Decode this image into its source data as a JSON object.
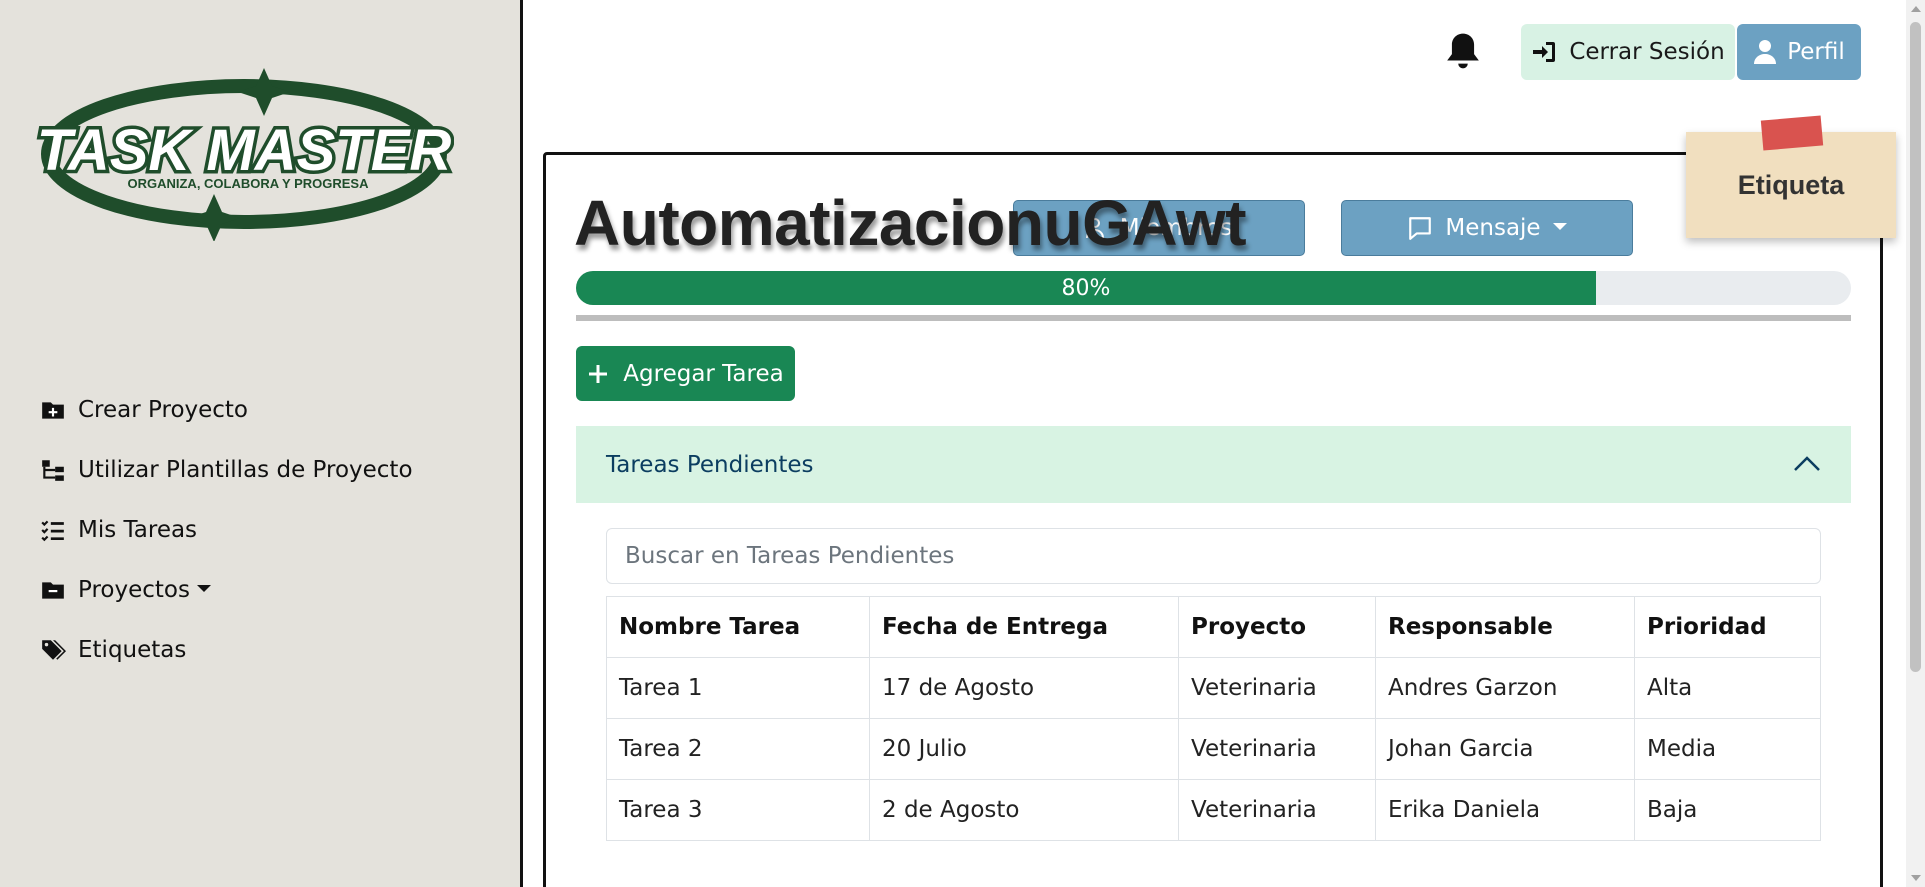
{
  "sidebar": {
    "logo": {
      "title": "TASK MASTER",
      "tagline": "ORGANIZA, COLABORA Y PROGRESA",
      "color": "#1f4d2b"
    },
    "items": [
      {
        "label": "Crear Proyecto",
        "icon": "folder-plus-icon"
      },
      {
        "label": "Utilizar Plantillas de Proyecto",
        "icon": "diagram-icon"
      },
      {
        "label": "Mis Tareas",
        "icon": "list-check-icon"
      },
      {
        "label": "Proyectos",
        "icon": "folder-minus-icon"
      },
      {
        "label": "Etiquetas",
        "icon": "tags-icon"
      }
    ]
  },
  "header": {
    "notifications_icon": "bell-icon",
    "logout_label": "Cerrar Sesión",
    "profile_label": "Perfil"
  },
  "note": {
    "label": "Etiqueta"
  },
  "project": {
    "title": "AutomatizacionuGAwt",
    "members_label": "Miembros",
    "message_label": "Mensaje",
    "progress": 0.8,
    "progress_label": "80%",
    "add_task_label": "Agregar Tarea"
  },
  "pending": {
    "header": "Tareas Pendientes",
    "search_placeholder": "Buscar en Tareas Pendientes",
    "columns": [
      "Nombre Tarea",
      "Fecha de Entrega",
      "Proyecto",
      "Responsable",
      "Prioridad"
    ],
    "rows": [
      [
        "Tarea 1",
        "17 de Agosto",
        "Veterinaria",
        "Andres Garzon",
        "Alta"
      ],
      [
        "Tarea 2",
        "20 Julio",
        "Veterinaria",
        "Johan Garcia",
        "Media"
      ],
      [
        "Tarea 3",
        "2 de Agosto",
        "Veterinaria",
        "Erika Daniela",
        "Baja"
      ]
    ]
  },
  "colors": {
    "primary_blue": "#6ca1c2",
    "success_green": "#198754",
    "accordion_bg": "#d8f3e3",
    "sidebar_bg": "#e4e2dc"
  }
}
